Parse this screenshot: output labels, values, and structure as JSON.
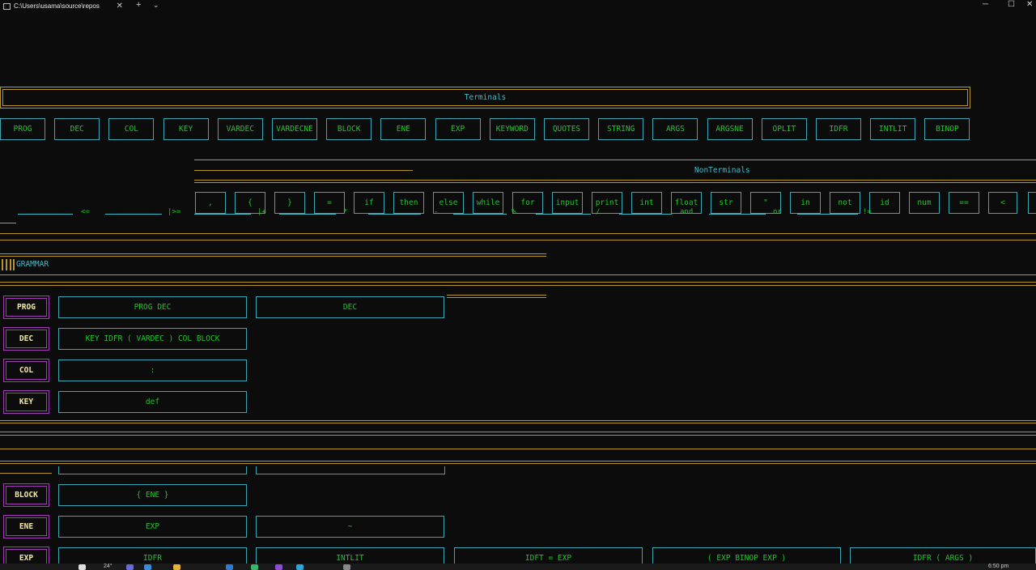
{
  "window": {
    "tab_title": "C:\\Users\\usama\\source\\repos",
    "tab_close": "✕",
    "new_tab": "+",
    "dropdown": "⌄",
    "minimize": "─",
    "maximize": "☐",
    "close": "✕"
  },
  "terminals": {
    "title": "Terminals",
    "items": [
      "PROG",
      "DEC",
      "COL",
      "KEY",
      "VARDEC",
      "VARDECNE",
      "BLOCK",
      "ENE",
      "EXP",
      "KEYWORD",
      "QUOTES",
      "STRING",
      "ARGS",
      "ARGSNE",
      "OPLIT",
      "IDFR",
      "INTLIT",
      "BINOP"
    ]
  },
  "nonterminals": {
    "title": "NonTerminals",
    "items": [
      ",",
      "{",
      "}",
      "=",
      "if",
      "then",
      "else",
      "while",
      "for",
      "input",
      "print",
      "int",
      "float",
      "str",
      "\"",
      "in",
      "not",
      "id",
      "num",
      "==",
      "<"
    ],
    "operators": [
      "<=",
      "|>=",
      "|+",
      "*",
      "-",
      "%",
      "/",
      "and",
      "or",
      "!="
    ]
  },
  "grammar": {
    "title": "GRAMMAR",
    "rules": [
      {
        "lhs": "PROG",
        "rhs": [
          "PROG DEC",
          "DEC"
        ]
      },
      {
        "lhs": "DEC",
        "rhs": [
          "KEY IDFR ( VARDEC ) COL BLOCK"
        ]
      },
      {
        "lhs": "COL",
        "rhs": [
          ":"
        ]
      },
      {
        "lhs": "KEY",
        "rhs": [
          "def"
        ]
      },
      {
        "lhs": "BLOCK",
        "rhs": [
          "{ ENE }"
        ]
      },
      {
        "lhs": "ENE",
        "rhs": [
          "EXP",
          "~"
        ]
      },
      {
        "lhs": "EXP",
        "rhs": [
          "IDFR",
          "INTLIT",
          "IDFT = EXP",
          "( EXP BINOP EXP )",
          "IDFR ( ARGS )"
        ]
      }
    ]
  },
  "taskbar": {
    "weather": "24°",
    "time": "6:50 pm"
  }
}
